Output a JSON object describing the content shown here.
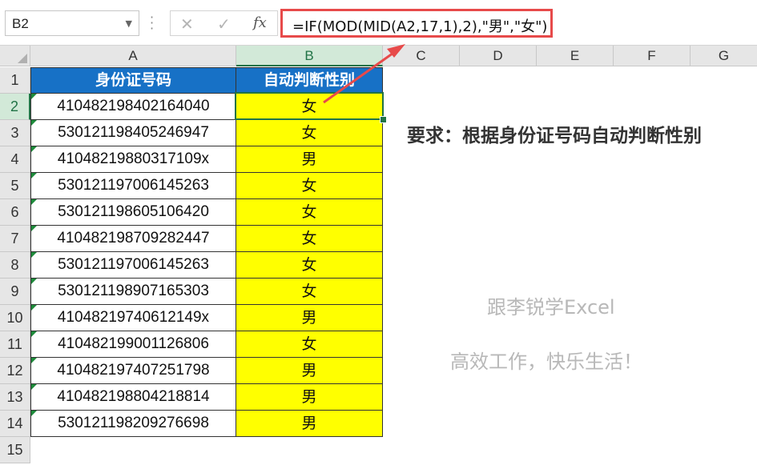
{
  "formula_bar": {
    "name_box": "B2",
    "cancel_glyph": "✕",
    "enter_glyph": "✓",
    "fx_label": "fx",
    "formula": "=IF(MOD(MID(A2,17,1),2),\"男\",\"女\")"
  },
  "columns": [
    "A",
    "B",
    "C",
    "D",
    "E",
    "F",
    "G"
  ],
  "rows": [
    "1",
    "2",
    "3",
    "4",
    "5",
    "6",
    "7",
    "8",
    "9",
    "10",
    "11",
    "12",
    "13",
    "14",
    "15"
  ],
  "table": {
    "header_a": "身份证号码",
    "header_b": "自动判断性别",
    "records": [
      {
        "id": "410482198402164040",
        "gender": "女"
      },
      {
        "id": "530121198405246947",
        "gender": "女"
      },
      {
        "id": "41048219880317109x",
        "gender": "男"
      },
      {
        "id": "530121197006145263",
        "gender": "女"
      },
      {
        "id": "530121198605106420",
        "gender": "女"
      },
      {
        "id": "410482198709282447",
        "gender": "女"
      },
      {
        "id": "530121197006145263",
        "gender": "女"
      },
      {
        "id": "530121198907165303",
        "gender": "女"
      },
      {
        "id": "41048219740612149x",
        "gender": "男"
      },
      {
        "id": "410482199001126806",
        "gender": "女"
      },
      {
        "id": "410482197407251798",
        "gender": "男"
      },
      {
        "id": "410482198804218814",
        "gender": "男"
      },
      {
        "id": "530121198209276698",
        "gender": "男"
      }
    ]
  },
  "requirement": "要求：根据身份证号码自动判断性别",
  "watermark_1": "跟李锐学Excel",
  "watermark_2": "高效工作，快乐生活！",
  "colors": {
    "header_fill": "#1771c6",
    "result_fill": "#ffff00",
    "highlight_border": "#e74a4a",
    "selection": "#217346"
  }
}
